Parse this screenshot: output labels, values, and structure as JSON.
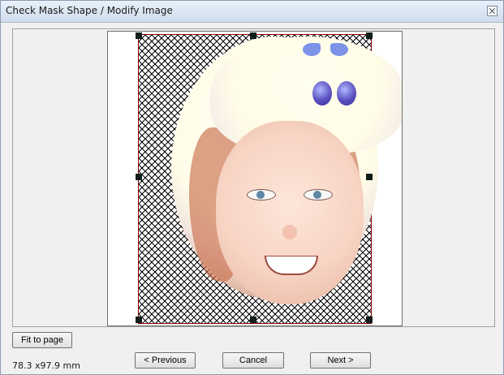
{
  "window": {
    "title": "Check Mask Shape / Modify Image"
  },
  "controls": {
    "fit_to_page": "Fit to page"
  },
  "status": {
    "dimensions": "78.3 x97.9 mm"
  },
  "navigation": {
    "previous": "< Previous",
    "cancel": "Cancel",
    "next": "Next >"
  },
  "icons": {
    "close": "close-icon",
    "selection_handles": "square-handle-icon"
  },
  "colors": {
    "mask_outline": "#8a0000",
    "handle": "#0f1e1a",
    "button_border": "#707070"
  }
}
